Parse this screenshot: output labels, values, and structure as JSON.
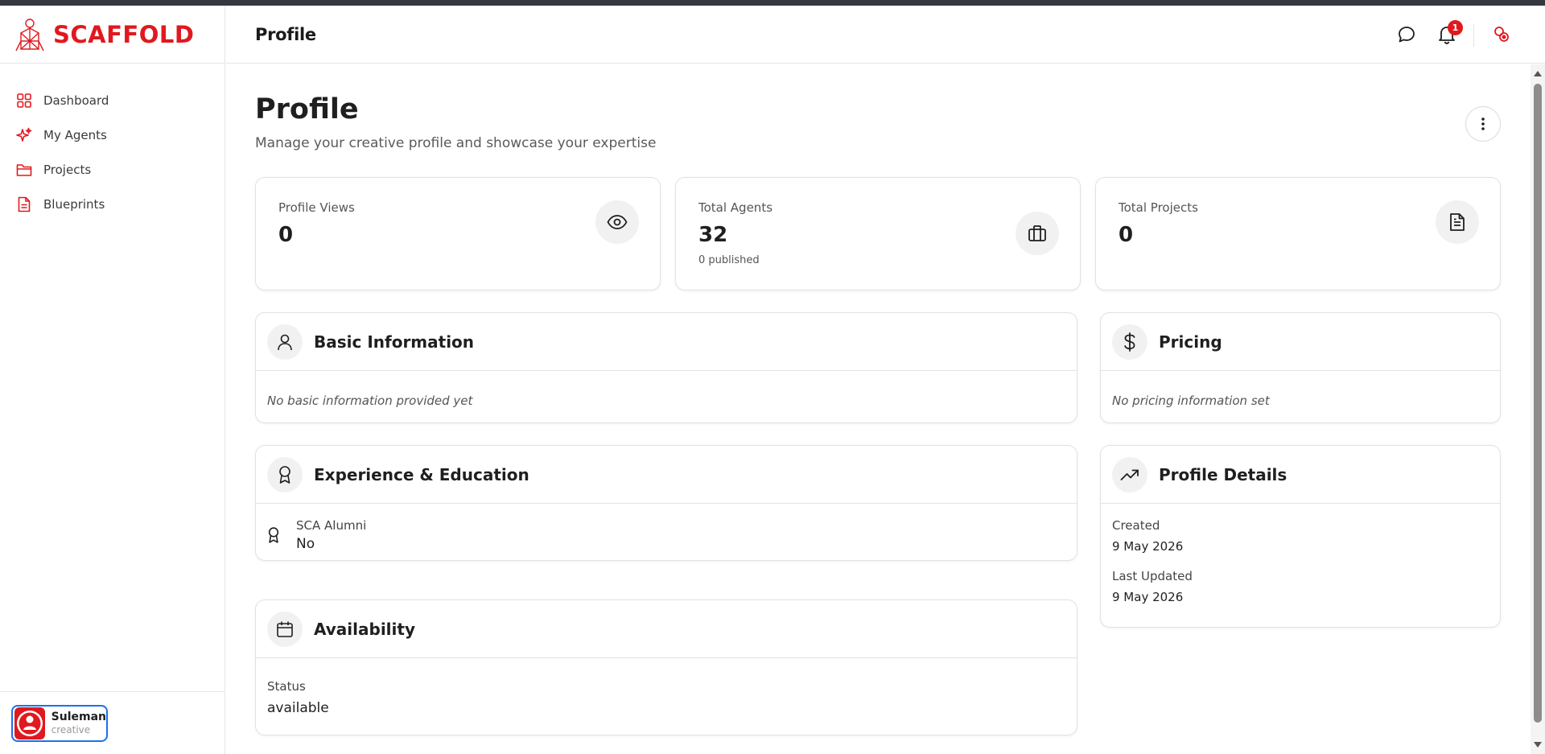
{
  "brand": {
    "name": "SCAFFOLD",
    "accent": "#e0191f"
  },
  "header": {
    "title": "Profile",
    "chat_icon": "message-circle-icon",
    "notifications": {
      "icon": "bell-icon",
      "count": "1"
    },
    "account_icon": "account-switch-icon"
  },
  "sidebar": {
    "items": [
      {
        "label": "Dashboard",
        "icon": "grid-icon"
      },
      {
        "label": "My Agents",
        "icon": "sparkles-icon"
      },
      {
        "label": "Projects",
        "icon": "folder-icon"
      },
      {
        "label": "Blueprints",
        "icon": "file-icon"
      }
    ],
    "user": {
      "name": "Suleman",
      "role": "creative"
    }
  },
  "page": {
    "title": "Profile",
    "subtitle": "Manage your creative profile and showcase your expertise"
  },
  "stats": [
    {
      "label": "Profile Views",
      "value": "0",
      "sub": "",
      "icon": "eye-icon"
    },
    {
      "label": "Total Agents",
      "value": "32",
      "sub": "0 published",
      "icon": "briefcase-icon"
    },
    {
      "label": "Total Projects",
      "value": "0",
      "sub": "",
      "icon": "document-icon"
    }
  ],
  "basic_info": {
    "title": "Basic Information",
    "empty": "No basic information provided yet"
  },
  "pricing": {
    "title": "Pricing",
    "empty": "No pricing information set"
  },
  "experience": {
    "title": "Experience & Education",
    "alumni_label": "SCA Alumni",
    "alumni_value": "No"
  },
  "profile_details": {
    "title": "Profile Details",
    "created_label": "Created",
    "created_value": "9 May 2026",
    "updated_label": "Last Updated",
    "updated_value": "9 May 2026"
  },
  "availability": {
    "title": "Availability",
    "status_label": "Status",
    "status_value": "available"
  }
}
